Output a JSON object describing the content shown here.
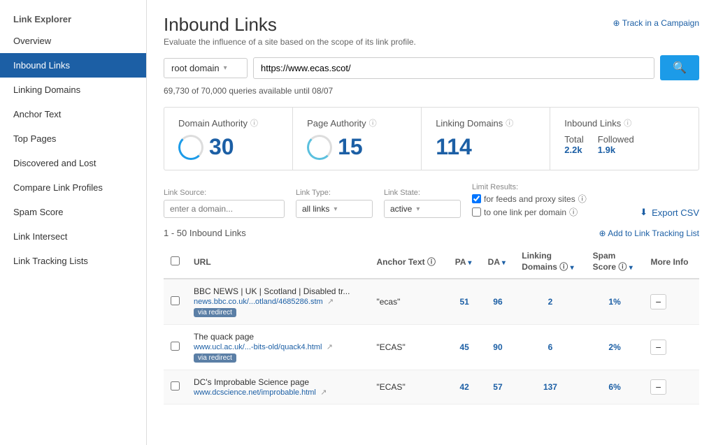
{
  "sidebar": {
    "group": "Link Explorer",
    "items": [
      {
        "id": "overview",
        "label": "Overview",
        "active": false
      },
      {
        "id": "inbound-links",
        "label": "Inbound Links",
        "active": true
      },
      {
        "id": "linking-domains",
        "label": "Linking Domains",
        "active": false
      },
      {
        "id": "anchor-text",
        "label": "Anchor Text",
        "active": false
      },
      {
        "id": "top-pages",
        "label": "Top Pages",
        "active": false
      },
      {
        "id": "discovered-lost",
        "label": "Discovered and Lost",
        "active": false
      },
      {
        "id": "compare-link",
        "label": "Compare Link Profiles",
        "active": false
      },
      {
        "id": "spam-score",
        "label": "Spam Score",
        "active": false
      },
      {
        "id": "link-intersect",
        "label": "Link Intersect",
        "active": false
      },
      {
        "id": "link-tracking",
        "label": "Link Tracking Lists",
        "active": false
      }
    ]
  },
  "page": {
    "title": "Inbound Links",
    "subtitle": "Evaluate the influence of a site based on the scope of its link profile.",
    "track_label": "Track in a Campaign"
  },
  "search": {
    "domain_type": "root domain",
    "url_value": "https://www.ecas.scot/",
    "search_icon": "🔍",
    "queries_text": "69,730 of 70,000 queries available until 08/07"
  },
  "metrics": {
    "domain_authority": {
      "label": "Domain Authority",
      "value": "30"
    },
    "page_authority": {
      "label": "Page Authority",
      "value": "15"
    },
    "linking_domains": {
      "label": "Linking Domains",
      "value": "114"
    },
    "inbound_links": {
      "label": "Inbound Links",
      "total_label": "Total",
      "total_value": "2.2k",
      "followed_label": "Followed",
      "followed_value": "1.9k"
    }
  },
  "filters": {
    "link_source_label": "Link Source:",
    "link_source_placeholder": "enter a domain...",
    "link_type_label": "Link Type:",
    "link_type_value": "all links",
    "link_state_label": "Link State:",
    "link_state_value": "active",
    "limit_label": "Limit Results:",
    "checkbox1": "for feeds and proxy sites",
    "checkbox2": "to one link per domain",
    "export_label": "Export CSV"
  },
  "results": {
    "count_text": "1 - 50 Inbound Links",
    "add_tracking_label": "Add to Link Tracking List"
  },
  "table": {
    "headers": [
      "",
      "URL",
      "Anchor Text",
      "PA",
      "DA",
      "Linking Domains",
      "Spam Score",
      "More Info"
    ],
    "rows": [
      {
        "title": "BBC NEWS | UK | Scotland | Disabled tr...",
        "url": "news.bbc.co.uk/...otland/4685286.stm",
        "anchor": "\"ecas\"",
        "pa": "51",
        "da": "96",
        "linking_domains": "2",
        "spam_score": "1%",
        "redirect": true
      },
      {
        "title": "The quack page",
        "url": "www.ucl.ac.uk/...-bits-old/quack4.html",
        "anchor": "\"ECAS\"",
        "pa": "45",
        "da": "90",
        "linking_domains": "6",
        "spam_score": "2%",
        "redirect": true
      },
      {
        "title": "DC's Improbable Science page",
        "url": "www.dcscience.net/improbable.html",
        "anchor": "\"ECAS\"",
        "pa": "42",
        "da": "57",
        "linking_domains": "137",
        "spam_score": "6%",
        "redirect": false
      }
    ]
  },
  "colors": {
    "accent": "#1c5fa5",
    "light_accent": "#1c9be8",
    "active_bg": "#1c5fa5"
  }
}
